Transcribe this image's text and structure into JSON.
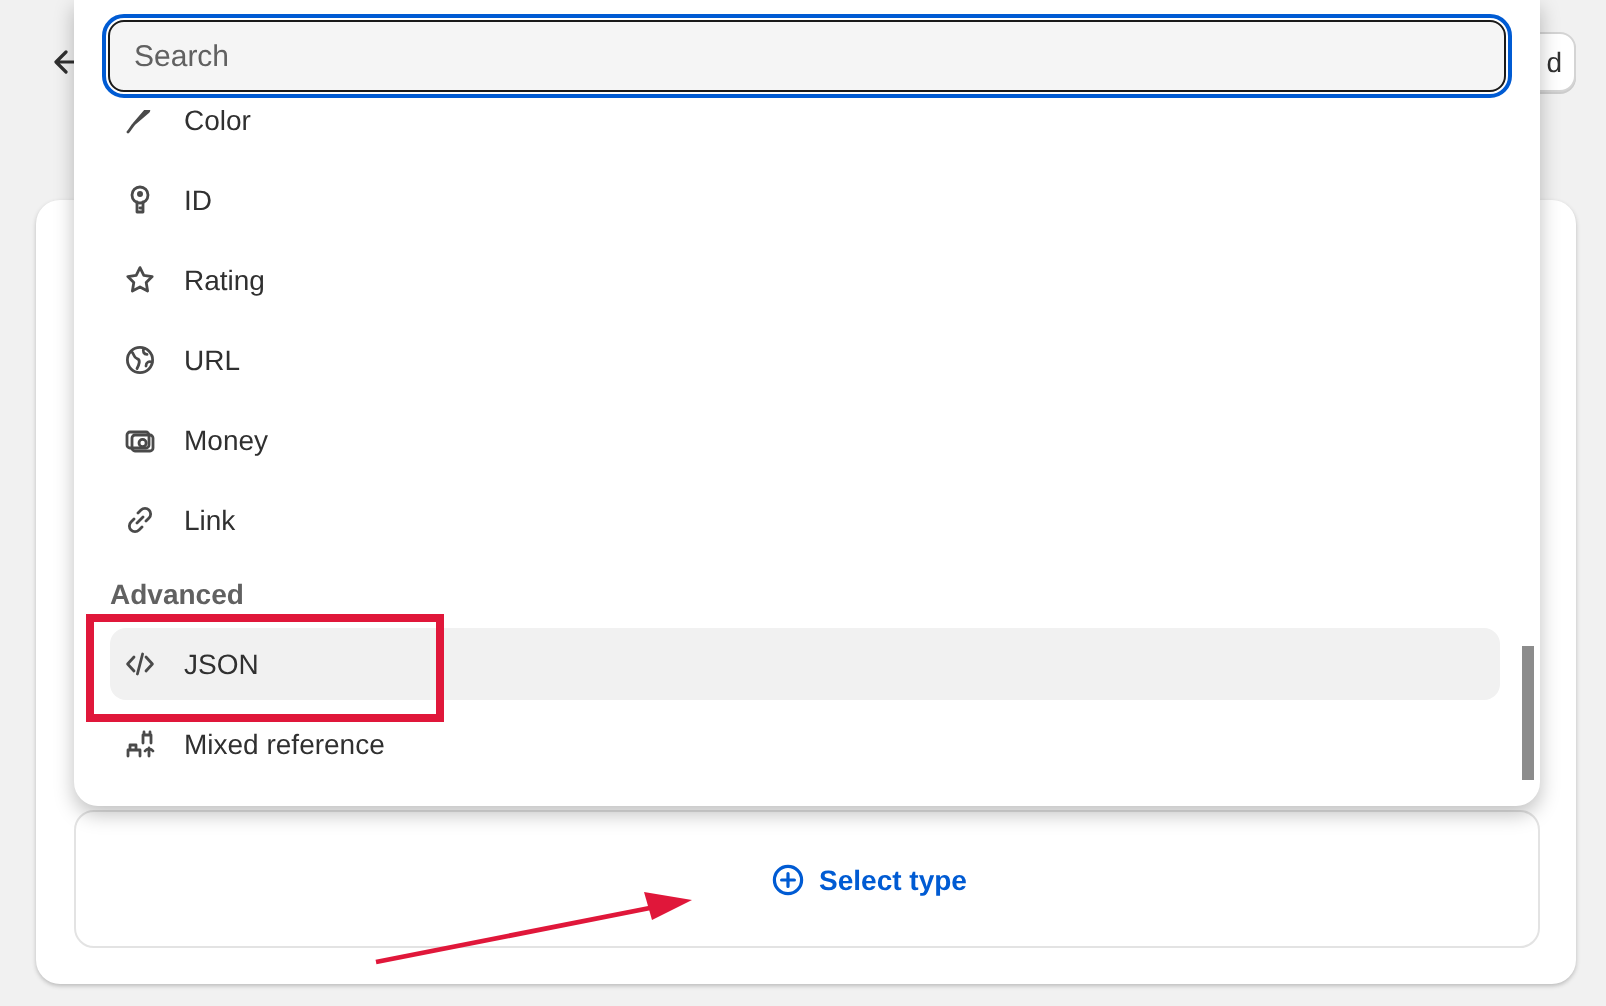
{
  "page": {
    "header_button": "d",
    "select_type": "Select type"
  },
  "dropdown": {
    "search": {
      "placeholder": "Search"
    },
    "sections": [
      {
        "items": [
          {
            "label": "Color",
            "selected": false
          },
          {
            "label": "ID",
            "selected": false
          },
          {
            "label": "Rating",
            "selected": false
          },
          {
            "label": "URL",
            "selected": false
          },
          {
            "label": "Money",
            "selected": false
          },
          {
            "label": "Link",
            "selected": false
          }
        ]
      },
      {
        "heading": "Advanced",
        "items": [
          {
            "label": "JSON",
            "selected": true
          },
          {
            "label": "Mixed reference",
            "selected": false
          }
        ]
      }
    ]
  }
}
